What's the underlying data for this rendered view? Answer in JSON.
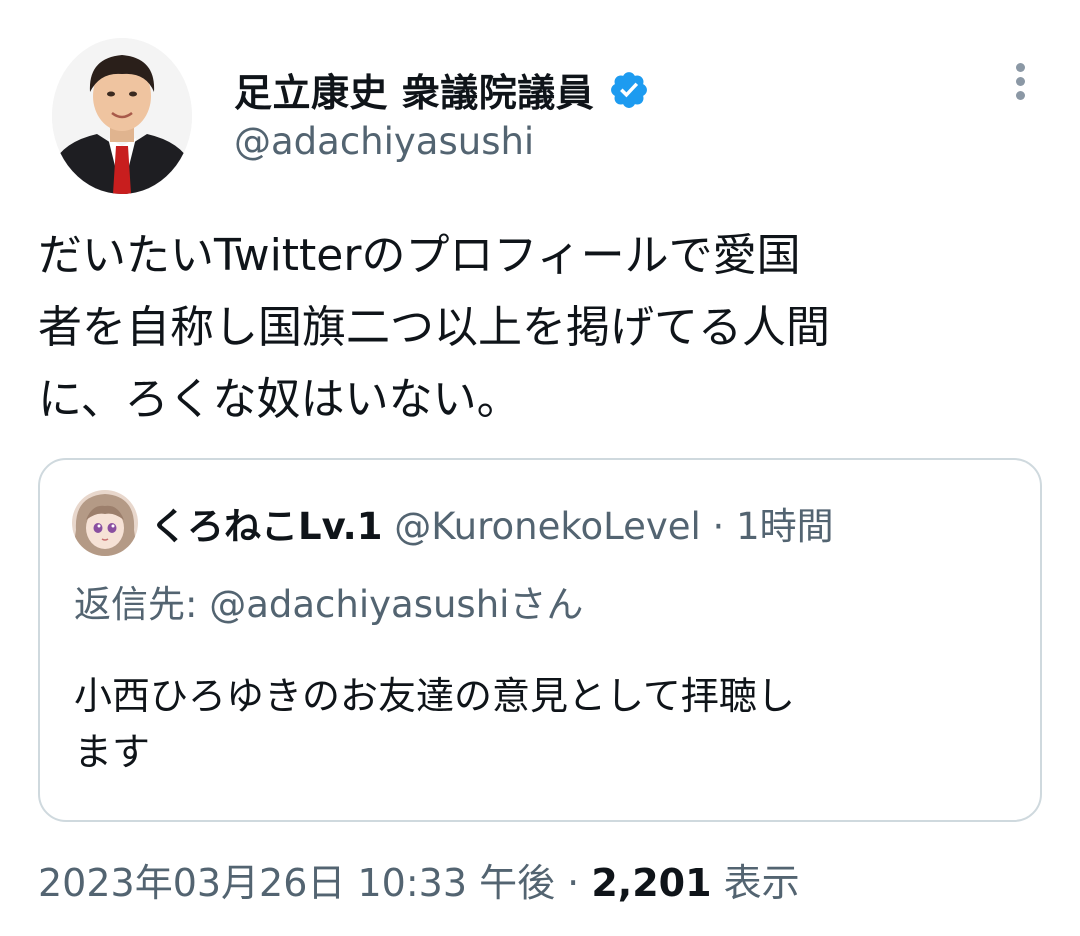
{
  "author": {
    "display_name": "足立康史 衆議院議員",
    "handle": "@adachiyasushi",
    "verified_icon": "verified-badge-icon",
    "verified_color": "#1d9bf0"
  },
  "tweet": {
    "lines": [
      "だいたいTwitterのプロフィールで愛国",
      "者を自称し国旗二つ以上を掲げてる人間",
      "に、ろくな奴はいない。"
    ]
  },
  "quoted": {
    "display_name": "くろねこLv.1",
    "handle": "@KuronekoLevel",
    "separator": " · ",
    "time": "1時間",
    "reply_to": "返信先: @adachiyasushiさん",
    "lines": [
      "小西ひろゆきのお友達の意見として拝聴し",
      "ます"
    ]
  },
  "footer": {
    "timestamp": "2023年03月26日 10:33 午後",
    "separator": " · ",
    "views_count": "2,201",
    "views_label": " 表示"
  },
  "colors": {
    "text": "#0f1419",
    "secondary": "#536471",
    "border": "#cfd9de",
    "accent": "#1d9bf0"
  }
}
